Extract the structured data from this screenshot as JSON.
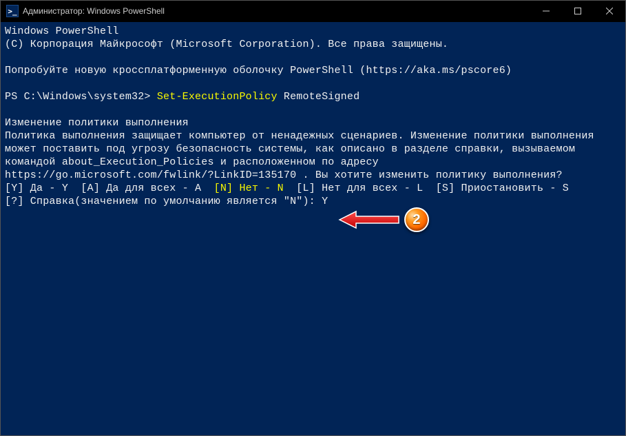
{
  "window": {
    "title": "Администратор: Windows PowerShell",
    "icon_glyph": ">_"
  },
  "terminal": {
    "line1": "Windows PowerShell",
    "line2": "(C) Корпорация Майкрософт (Microsoft Corporation). Все права защищены.",
    "line3": "Попробуйте новую кроссплатформенную оболочку PowerShell (https://aka.ms/pscore6)",
    "prompt_prefix": "PS C:\\Windows\\system32> ",
    "command": "Set-ExecutionPolicy",
    "command_arg": " RemoteSigned",
    "sec_title": "Изменение политики выполнения",
    "sec_body1": "Политика выполнения защищает компьютер от ненадежных сценариев. Изменение политики выполнения",
    "sec_body2": "может поставить под угрозу безопасность системы, как описано в разделе справки, вызываемом",
    "sec_body3": "командой about_Execution_Policies и расположенном по адресу",
    "sec_body4": "https://go.microsoft.com/fwlink/?LinkID=135170 . Вы хотите изменить политику выполнения?",
    "opt_y": "[Y] Да - Y  ",
    "opt_a": "[A] Да для всех - A  ",
    "opt_n": "[N] Нет - N",
    "opt_l": "  [L] Нет для всех - L  ",
    "opt_s": "[S] Приостановить - S",
    "help_line": "[?] Справка(значением по умолчанию является \"N\"): ",
    "user_input": "Y"
  },
  "annotation": {
    "badge_number": "2"
  }
}
